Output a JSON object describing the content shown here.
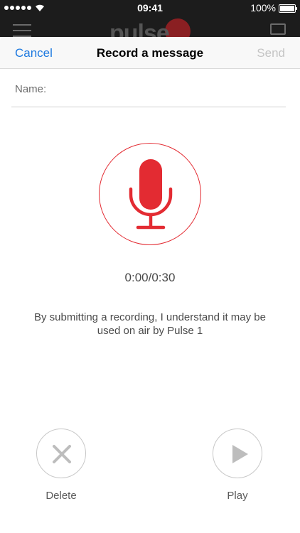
{
  "status_bar": {
    "time": "09:41",
    "battery": "100%"
  },
  "app_header": {
    "logo_text": "pulse"
  },
  "nav": {
    "cancel_label": "Cancel",
    "title": "Record a message",
    "send_label": "Send"
  },
  "form": {
    "name_label": "Name:",
    "name_value": ""
  },
  "recording": {
    "timer": "0:00/0:30",
    "disclaimer": "By submitting a recording, I understand it may be used on air by Pulse 1"
  },
  "controls": {
    "delete_label": "Delete",
    "play_label": "Play"
  },
  "colors": {
    "accent": "#e32b32",
    "link": "#1f7ae0",
    "disabled": "#c4c4c4"
  }
}
